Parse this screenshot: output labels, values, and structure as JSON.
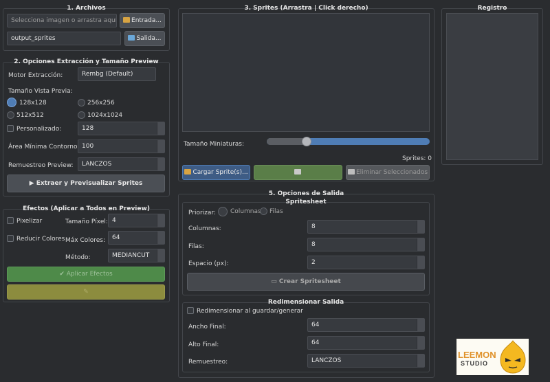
{
  "files": {
    "title": "1. Archivos",
    "input_placeholder": "Selecciona imagen o arrastra aquí...",
    "input_button": "Entrada...",
    "output_value": "output_sprites",
    "output_button": "Salida..."
  },
  "extraction": {
    "title": "2. Opciones Extracción y Tamaño Preview",
    "engine_label": "Motor Extracción:",
    "engine_value": "Rembg (Default)",
    "preview_size_label": "Tamaño Vista Previa:",
    "sizes": [
      "128x128",
      "256x256",
      "512x512",
      "1024x1024"
    ],
    "selected_size": "128x128",
    "custom_label": "Personalizado:",
    "custom_value": "128",
    "min_area_label": "Área Mínima Contorno:",
    "min_area_value": "100",
    "resample_label": "Remuestreo Preview:",
    "resample_value": "LANCZOS",
    "extract_button": "Extraer y Previsualizar Sprites"
  },
  "effects": {
    "title": "Efectos (Aplicar a Todos en Preview)",
    "pixelize_label": "Pixelizar",
    "pixel_size_label": "Tamaño Píxel:",
    "pixel_size_value": "4",
    "reduce_colors_label": "Reducir Colores",
    "max_colors_label": "Máx Colores:",
    "max_colors_value": "64",
    "method_label": "Método:",
    "method_value": "MEDIANCUT",
    "apply_button": "Aplicar Efectos"
  },
  "sprites": {
    "title": "3. Sprites (Arrastra | Click derecho)",
    "thumb_size_label": "Tamaño Miniaturas:",
    "thumb_slider_fraction": 0.25,
    "count_text": "Sprites: 0",
    "load_button": "Cargar Sprite(s)...",
    "delete_button": "Eliminar Seleccionados"
  },
  "output": {
    "title": "5. Opciones de Salida",
    "spritesheet_title": "Spritesheet",
    "prioritize_label": "Priorizar:",
    "prioritize_columns": "Columnas",
    "prioritize_rows": "Filas",
    "columns_label": "Columnas:",
    "columns_value": "8",
    "rows_label": "Filas:",
    "rows_value": "8",
    "spacing_label": "Espacio (px):",
    "spacing_value": "2",
    "create_button": "Crear Spritesheet",
    "resize_title": "Redimensionar Salida",
    "resize_checkbox": "Redimensionar al guardar/generar",
    "width_label": "Ancho Final:",
    "width_value": "64",
    "height_label": "Alto Final:",
    "height_value": "64",
    "resample_label": "Remuestreo:",
    "resample_value": "LANCZOS"
  },
  "log": {
    "title": "Registro"
  },
  "logo": {
    "line1": "LEEMON",
    "line2": "STUDIO"
  },
  "colors": {
    "accent_blue": "#4f7db5",
    "green_button": "#4e8a49",
    "olive_button": "#8c8c3e"
  }
}
